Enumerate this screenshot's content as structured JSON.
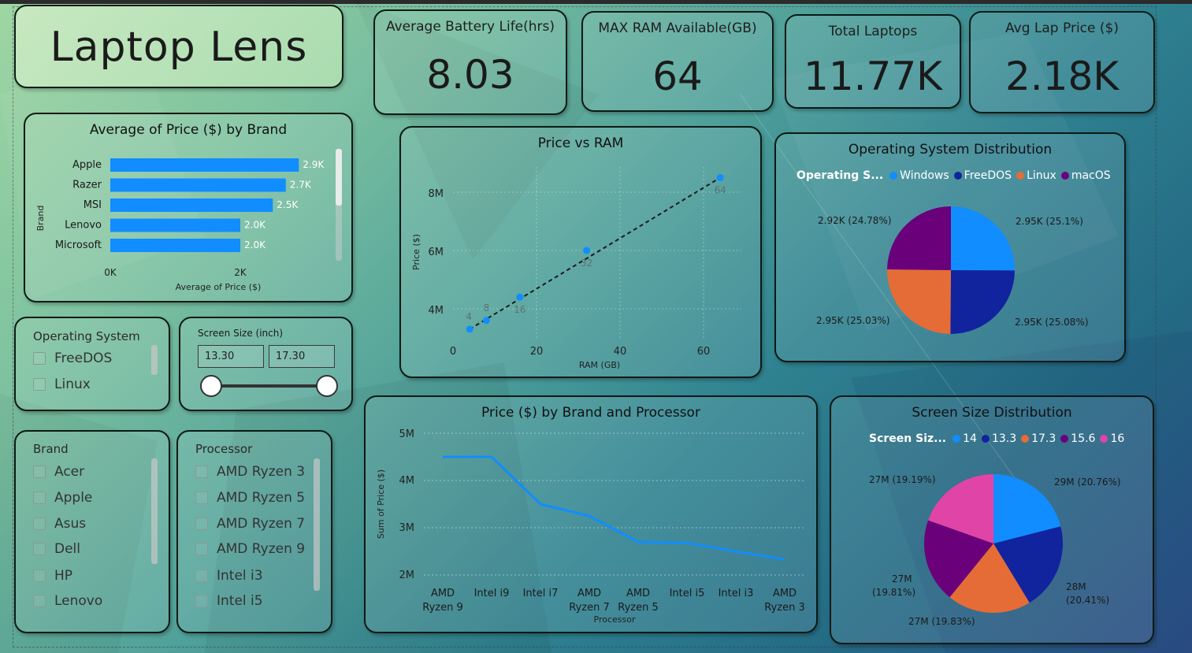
{
  "title": "Laptop Lens",
  "kpis": [
    {
      "label": "Average Battery Life(hrs)",
      "value": "8.03"
    },
    {
      "label": "MAX RAM Available(GB)",
      "value": "64"
    },
    {
      "label": "Total Laptops",
      "value": "11.77K"
    },
    {
      "label": "Avg Lap Price ($)",
      "value": "2.18K"
    }
  ],
  "brand_price": {
    "title": "Average of Price ($) by Brand",
    "ylabel": "Brand",
    "xlabel": "Average of Price ($)",
    "xticks": [
      "0K",
      "2K"
    ],
    "bar_color": "#118dff"
  },
  "scatter": {
    "title": "Price vs RAM",
    "xlabel": "RAM (GB)",
    "ylabel": "Price ($)",
    "xticks": [
      "0",
      "20",
      "40",
      "60"
    ],
    "yticks": [
      "4M",
      "6M",
      "8M"
    ]
  },
  "os_chart": {
    "title": "Operating System Distribution",
    "legend_title": "Operating S...",
    "slices": [
      {
        "name": "Windows",
        "label": "2.95K (25.1%)",
        "color": "#118dff"
      },
      {
        "name": "FreeDOS",
        "label": "2.95K (25.08%)",
        "color": "#12239e"
      },
      {
        "name": "Linux",
        "label": "2.95K (25.03%)",
        "color": "#e66c37"
      },
      {
        "name": "macOS",
        "label": "2.92K (24.78%)",
        "color": "#6b007b"
      }
    ]
  },
  "line_chart": {
    "title": "Price ($) by Brand and Processor",
    "xlabel": "Processor",
    "ylabel": "Sum of Price ($)",
    "yticks": [
      "2M",
      "3M",
      "4M",
      "5M"
    ],
    "line_color": "#118dff"
  },
  "screen_chart": {
    "title": "Screen Size Distribution",
    "legend_title": "Screen Siz...",
    "slices": [
      {
        "name": "14",
        "label": "29M (20.76%)",
        "color": "#118dff"
      },
      {
        "name": "13.3",
        "label": "28M (20.41%)",
        "color": "#12239e"
      },
      {
        "name": "17.3",
        "label": "27M (19.83%)",
        "color": "#e66c37"
      },
      {
        "name": "15.6",
        "label": "27M (19.81%)",
        "color": "#6b007b"
      },
      {
        "name": "16",
        "label": "27M (19.19%)",
        "color": "#e044a7"
      }
    ]
  },
  "slicers": {
    "os": {
      "title": "Operating System",
      "items": [
        "FreeDOS",
        "Linux"
      ]
    },
    "screen": {
      "title": "Screen Size (inch)",
      "min": "13.30",
      "max": "17.30"
    },
    "brand": {
      "title": "Brand",
      "items": [
        "Acer",
        "Apple",
        "Asus",
        "Dell",
        "HP",
        "Lenovo"
      ]
    },
    "processor": {
      "title": "Processor",
      "items": [
        "AMD Ryzen 3",
        "AMD Ryzen 5",
        "AMD Ryzen 7",
        "AMD Ryzen 9",
        "Intel i3",
        "Intel i5"
      ]
    }
  },
  "chart_data": [
    {
      "type": "bar",
      "title": "Average of Price ($) by Brand",
      "categories": [
        "Apple",
        "Razer",
        "MSI",
        "Lenovo",
        "Microsoft"
      ],
      "values": [
        2900,
        2700,
        2500,
        2000,
        2000
      ],
      "value_labels": [
        "2.9K",
        "2.7K",
        "2.5K",
        "2.0K",
        "2.0K"
      ],
      "xlim": [
        0,
        3000
      ],
      "xlabel": "Average of Price ($)",
      "ylabel": "Brand"
    },
    {
      "type": "scatter",
      "title": "Price vs RAM",
      "x": [
        4,
        8,
        16,
        32,
        64
      ],
      "y": [
        3300000,
        3600000,
        4400000,
        6000000,
        8500000
      ],
      "point_labels": [
        "4",
        "8",
        "16",
        "32",
        "64"
      ],
      "xlim": [
        0,
        68
      ],
      "ylim": [
        2700000,
        9000000
      ],
      "trendline": true,
      "xlabel": "RAM (GB)",
      "ylabel": "Price ($)"
    },
    {
      "type": "pie",
      "title": "Operating System Distribution",
      "categories": [
        "Windows",
        "FreeDOS",
        "Linux",
        "macOS"
      ],
      "values": [
        2950,
        2950,
        2950,
        2920
      ],
      "percent": [
        25.1,
        25.08,
        25.03,
        24.78
      ]
    },
    {
      "type": "line",
      "title": "Price ($) by Brand and Processor",
      "categories": [
        "AMD Ryzen 9",
        "Intel i9",
        "Intel i7",
        "AMD Ryzen 7",
        "AMD Ryzen 5",
        "Intel i5",
        "Intel i3",
        "AMD Ryzen 3"
      ],
      "values": [
        4500000,
        4500000,
        3500000,
        3250000,
        2700000,
        2680000,
        2500000,
        2330000
      ],
      "ylim": [
        2000000,
        5000000
      ],
      "xlabel": "Processor",
      "ylabel": "Sum of Price ($)"
    },
    {
      "type": "pie",
      "title": "Screen Size Distribution",
      "categories": [
        "14",
        "13.3",
        "17.3",
        "15.6",
        "16"
      ],
      "values": [
        29000000,
        28000000,
        27000000,
        27000000,
        27000000
      ],
      "percent": [
        20.76,
        20.41,
        19.83,
        19.81,
        19.19
      ]
    }
  ]
}
